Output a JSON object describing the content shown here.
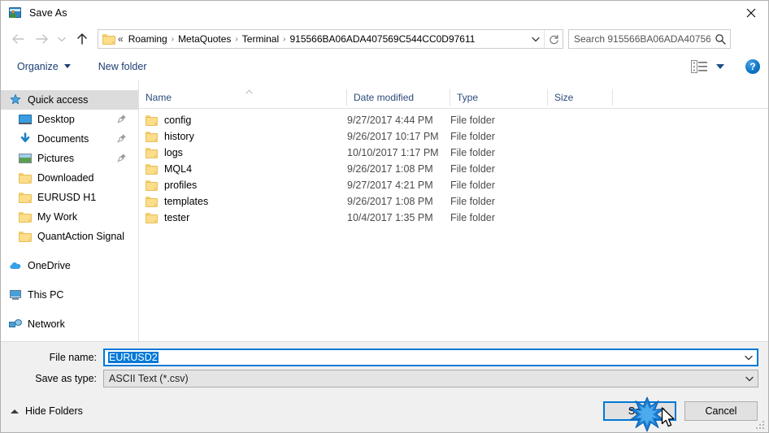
{
  "window": {
    "title": "Save As",
    "icon": "save-as-icon",
    "close_label": "✕"
  },
  "nav": {
    "back_icon": "arrow-left-icon",
    "forward_icon": "arrow-right-icon",
    "recent_icon": "chevron-down-icon",
    "up_icon": "arrow-up-icon",
    "refresh_icon": "refresh-icon",
    "address_chevron_icon": "chevron-down-icon"
  },
  "address": {
    "folder_icon": "folder-icon",
    "overflow": "«",
    "separator": "›",
    "crumbs": [
      "Roaming",
      "MetaQuotes",
      "Terminal",
      "915566BA06ADA407569C544CC0D97611"
    ]
  },
  "search": {
    "value": "",
    "placeholder": "Search 915566BA06ADA40756…",
    "icon": "search-icon"
  },
  "toolbar": {
    "organize_label": "Organize",
    "new_folder_label": "New folder",
    "view_icon": "view-options-icon",
    "help_icon": "help-icon",
    "help_glyph": "?"
  },
  "sidebar": {
    "items": [
      {
        "label": "Quick access",
        "icon": "star-icon",
        "selected": true,
        "pinned": false,
        "root": true
      },
      {
        "label": "Desktop",
        "icon": "desktop-icon",
        "selected": false,
        "pinned": true,
        "root": false
      },
      {
        "label": "Documents",
        "icon": "documents-icon",
        "selected": false,
        "pinned": true,
        "root": false
      },
      {
        "label": "Pictures",
        "icon": "pictures-icon",
        "selected": false,
        "pinned": true,
        "root": false
      },
      {
        "label": "Downloaded",
        "icon": "folder-icon",
        "selected": false,
        "pinned": false,
        "root": false
      },
      {
        "label": "EURUSD H1",
        "icon": "folder-icon",
        "selected": false,
        "pinned": false,
        "root": false
      },
      {
        "label": "My Work",
        "icon": "folder-icon",
        "selected": false,
        "pinned": false,
        "root": false
      },
      {
        "label": "QuantAction Signal",
        "icon": "folder-icon",
        "selected": false,
        "pinned": false,
        "root": false
      },
      {
        "label": "OneDrive",
        "icon": "onedrive-icon",
        "selected": false,
        "pinned": false,
        "root": true,
        "gap_before": true
      },
      {
        "label": "This PC",
        "icon": "this-pc-icon",
        "selected": false,
        "pinned": false,
        "root": true,
        "gap_before": true
      },
      {
        "label": "Network",
        "icon": "network-icon",
        "selected": false,
        "pinned": false,
        "root": true,
        "gap_before": true
      }
    ]
  },
  "filelist": {
    "columns": [
      "Name",
      "Date modified",
      "Type",
      "Size"
    ],
    "sort_indicator": "ascending",
    "rows": [
      {
        "name": "config",
        "date": "9/27/2017 4:44 PM",
        "type": "File folder",
        "size": ""
      },
      {
        "name": "history",
        "date": "9/26/2017 10:17 PM",
        "type": "File folder",
        "size": ""
      },
      {
        "name": "logs",
        "date": "10/10/2017 1:17 PM",
        "type": "File folder",
        "size": ""
      },
      {
        "name": "MQL4",
        "date": "9/26/2017 1:08 PM",
        "type": "File folder",
        "size": ""
      },
      {
        "name": "profiles",
        "date": "9/27/2017 4:21 PM",
        "type": "File folder",
        "size": ""
      },
      {
        "name": "templates",
        "date": "9/26/2017 1:08 PM",
        "type": "File folder",
        "size": ""
      },
      {
        "name": "tester",
        "date": "10/4/2017 1:35 PM",
        "type": "File folder",
        "size": ""
      }
    ]
  },
  "form": {
    "filename_label": "File name:",
    "filename_value": "EURUSD2",
    "filetype_label": "Save as type:",
    "filetype_value": "ASCII Text (*.csv)",
    "dropdown_icon": "chevron-down-icon"
  },
  "footer": {
    "hide_folders_label": "Hide Folders",
    "hide_folders_icon": "chevron-up-icon",
    "save_label": "Save",
    "cancel_label": "Cancel",
    "resize_grip_icon": "resize-grip-icon",
    "cursor_icon": "mouse-pointer-icon",
    "click_effect_icon": "click-burst-icon"
  },
  "colors": {
    "accent": "#0078d7",
    "folder": "#fbdd8a",
    "toolbar_link": "#1b3d73",
    "column_header": "#2b4a7a"
  }
}
